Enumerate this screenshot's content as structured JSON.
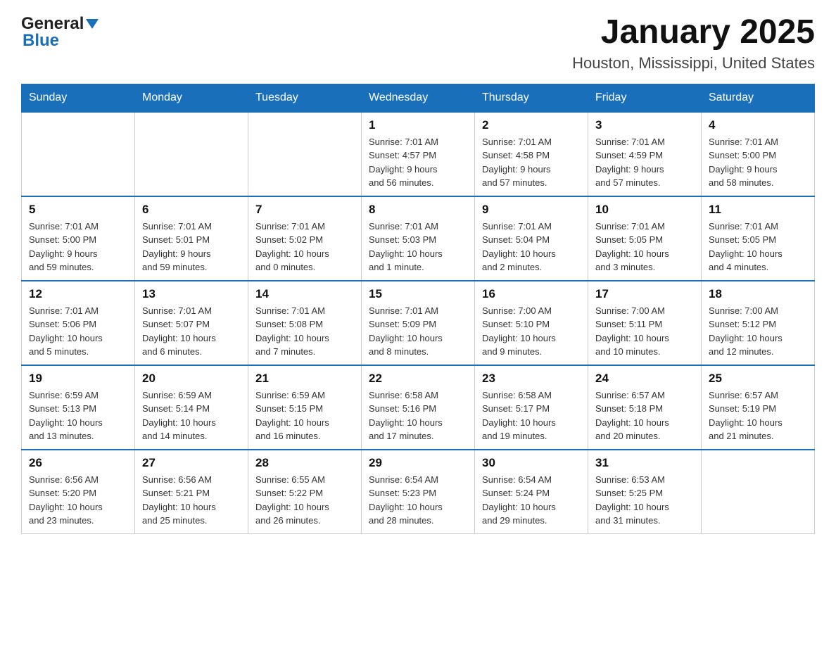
{
  "header": {
    "logo": {
      "text_general": "General",
      "text_blue": "Blue",
      "alt": "GeneralBlue logo"
    },
    "title": "January 2025",
    "subtitle": "Houston, Mississippi, United States"
  },
  "days_of_week": [
    "Sunday",
    "Monday",
    "Tuesday",
    "Wednesday",
    "Thursday",
    "Friday",
    "Saturday"
  ],
  "weeks": [
    [
      {
        "day": "",
        "info": ""
      },
      {
        "day": "",
        "info": ""
      },
      {
        "day": "",
        "info": ""
      },
      {
        "day": "1",
        "info": "Sunrise: 7:01 AM\nSunset: 4:57 PM\nDaylight: 9 hours\nand 56 minutes."
      },
      {
        "day": "2",
        "info": "Sunrise: 7:01 AM\nSunset: 4:58 PM\nDaylight: 9 hours\nand 57 minutes."
      },
      {
        "day": "3",
        "info": "Sunrise: 7:01 AM\nSunset: 4:59 PM\nDaylight: 9 hours\nand 57 minutes."
      },
      {
        "day": "4",
        "info": "Sunrise: 7:01 AM\nSunset: 5:00 PM\nDaylight: 9 hours\nand 58 minutes."
      }
    ],
    [
      {
        "day": "5",
        "info": "Sunrise: 7:01 AM\nSunset: 5:00 PM\nDaylight: 9 hours\nand 59 minutes."
      },
      {
        "day": "6",
        "info": "Sunrise: 7:01 AM\nSunset: 5:01 PM\nDaylight: 9 hours\nand 59 minutes."
      },
      {
        "day": "7",
        "info": "Sunrise: 7:01 AM\nSunset: 5:02 PM\nDaylight: 10 hours\nand 0 minutes."
      },
      {
        "day": "8",
        "info": "Sunrise: 7:01 AM\nSunset: 5:03 PM\nDaylight: 10 hours\nand 1 minute."
      },
      {
        "day": "9",
        "info": "Sunrise: 7:01 AM\nSunset: 5:04 PM\nDaylight: 10 hours\nand 2 minutes."
      },
      {
        "day": "10",
        "info": "Sunrise: 7:01 AM\nSunset: 5:05 PM\nDaylight: 10 hours\nand 3 minutes."
      },
      {
        "day": "11",
        "info": "Sunrise: 7:01 AM\nSunset: 5:05 PM\nDaylight: 10 hours\nand 4 minutes."
      }
    ],
    [
      {
        "day": "12",
        "info": "Sunrise: 7:01 AM\nSunset: 5:06 PM\nDaylight: 10 hours\nand 5 minutes."
      },
      {
        "day": "13",
        "info": "Sunrise: 7:01 AM\nSunset: 5:07 PM\nDaylight: 10 hours\nand 6 minutes."
      },
      {
        "day": "14",
        "info": "Sunrise: 7:01 AM\nSunset: 5:08 PM\nDaylight: 10 hours\nand 7 minutes."
      },
      {
        "day": "15",
        "info": "Sunrise: 7:01 AM\nSunset: 5:09 PM\nDaylight: 10 hours\nand 8 minutes."
      },
      {
        "day": "16",
        "info": "Sunrise: 7:00 AM\nSunset: 5:10 PM\nDaylight: 10 hours\nand 9 minutes."
      },
      {
        "day": "17",
        "info": "Sunrise: 7:00 AM\nSunset: 5:11 PM\nDaylight: 10 hours\nand 10 minutes."
      },
      {
        "day": "18",
        "info": "Sunrise: 7:00 AM\nSunset: 5:12 PM\nDaylight: 10 hours\nand 12 minutes."
      }
    ],
    [
      {
        "day": "19",
        "info": "Sunrise: 6:59 AM\nSunset: 5:13 PM\nDaylight: 10 hours\nand 13 minutes."
      },
      {
        "day": "20",
        "info": "Sunrise: 6:59 AM\nSunset: 5:14 PM\nDaylight: 10 hours\nand 14 minutes."
      },
      {
        "day": "21",
        "info": "Sunrise: 6:59 AM\nSunset: 5:15 PM\nDaylight: 10 hours\nand 16 minutes."
      },
      {
        "day": "22",
        "info": "Sunrise: 6:58 AM\nSunset: 5:16 PM\nDaylight: 10 hours\nand 17 minutes."
      },
      {
        "day": "23",
        "info": "Sunrise: 6:58 AM\nSunset: 5:17 PM\nDaylight: 10 hours\nand 19 minutes."
      },
      {
        "day": "24",
        "info": "Sunrise: 6:57 AM\nSunset: 5:18 PM\nDaylight: 10 hours\nand 20 minutes."
      },
      {
        "day": "25",
        "info": "Sunrise: 6:57 AM\nSunset: 5:19 PM\nDaylight: 10 hours\nand 21 minutes."
      }
    ],
    [
      {
        "day": "26",
        "info": "Sunrise: 6:56 AM\nSunset: 5:20 PM\nDaylight: 10 hours\nand 23 minutes."
      },
      {
        "day": "27",
        "info": "Sunrise: 6:56 AM\nSunset: 5:21 PM\nDaylight: 10 hours\nand 25 minutes."
      },
      {
        "day": "28",
        "info": "Sunrise: 6:55 AM\nSunset: 5:22 PM\nDaylight: 10 hours\nand 26 minutes."
      },
      {
        "day": "29",
        "info": "Sunrise: 6:54 AM\nSunset: 5:23 PM\nDaylight: 10 hours\nand 28 minutes."
      },
      {
        "day": "30",
        "info": "Sunrise: 6:54 AM\nSunset: 5:24 PM\nDaylight: 10 hours\nand 29 minutes."
      },
      {
        "day": "31",
        "info": "Sunrise: 6:53 AM\nSunset: 5:25 PM\nDaylight: 10 hours\nand 31 minutes."
      },
      {
        "day": "",
        "info": ""
      }
    ]
  ]
}
